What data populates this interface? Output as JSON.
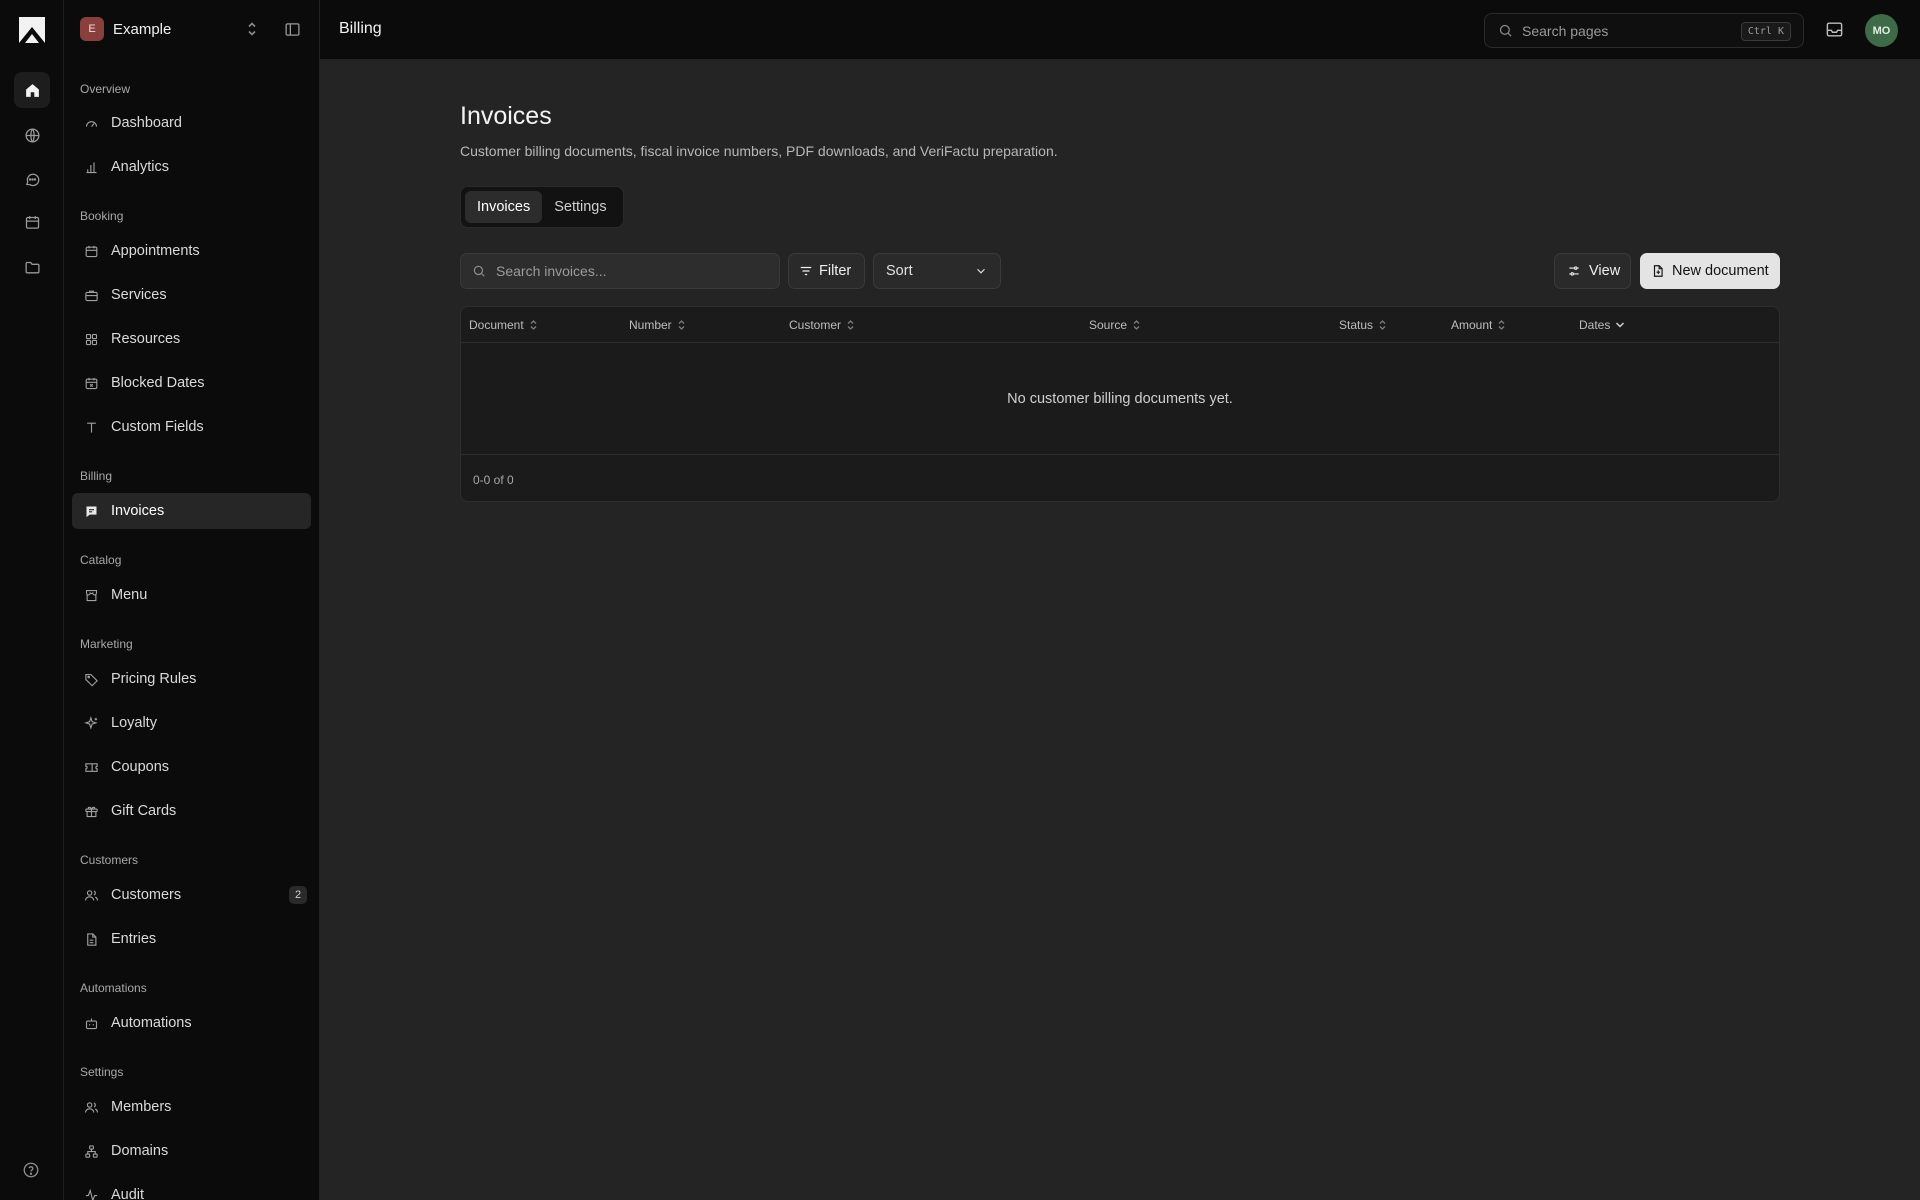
{
  "workspace": {
    "initial": "E",
    "name": "Example"
  },
  "topbar": {
    "title": "Billing",
    "search_placeholder": "Search pages",
    "shortcut": "Ctrl K",
    "user_initials": "MO"
  },
  "sidebar": {
    "sections": [
      {
        "label": "Overview",
        "items": [
          {
            "label": "Dashboard",
            "icon": "gauge-icon"
          },
          {
            "label": "Analytics",
            "icon": "bar-chart-icon"
          }
        ]
      },
      {
        "label": "Booking",
        "items": [
          {
            "label": "Appointments",
            "icon": "calendar-icon"
          },
          {
            "label": "Services",
            "icon": "briefcase-icon"
          },
          {
            "label": "Resources",
            "icon": "grid-icon"
          },
          {
            "label": "Blocked Dates",
            "icon": "calendar-x-icon"
          },
          {
            "label": "Custom Fields",
            "icon": "text-icon"
          }
        ]
      },
      {
        "label": "Billing",
        "items": [
          {
            "label": "Invoices",
            "icon": "invoice-icon",
            "active": true
          }
        ]
      },
      {
        "label": "Catalog",
        "items": [
          {
            "label": "Menu",
            "icon": "store-icon"
          }
        ]
      },
      {
        "label": "Marketing",
        "items": [
          {
            "label": "Pricing Rules",
            "icon": "tag-icon"
          },
          {
            "label": "Loyalty",
            "icon": "sparkle-icon"
          },
          {
            "label": "Coupons",
            "icon": "ticket-icon"
          },
          {
            "label": "Gift Cards",
            "icon": "gift-icon"
          }
        ]
      },
      {
        "label": "Customers",
        "items": [
          {
            "label": "Customers",
            "icon": "users-icon",
            "badge": "2"
          },
          {
            "label": "Entries",
            "icon": "file-icon"
          }
        ]
      },
      {
        "label": "Automations",
        "items": [
          {
            "label": "Automations",
            "icon": "bot-icon"
          }
        ]
      },
      {
        "label": "Settings",
        "items": [
          {
            "label": "Members",
            "icon": "users-icon"
          },
          {
            "label": "Domains",
            "icon": "network-icon"
          },
          {
            "label": "Audit",
            "icon": "activity-icon"
          }
        ]
      }
    ]
  },
  "main": {
    "title": "Invoices",
    "description": "Customer billing documents, fiscal invoice numbers, PDF downloads, and VeriFactu preparation.",
    "tabs": [
      {
        "label": "Invoices",
        "active": true
      },
      {
        "label": "Settings"
      }
    ],
    "search_placeholder": "Search invoices...",
    "filter_label": "Filter",
    "sort_label": "Sort",
    "view_label": "View",
    "new_label": "New document",
    "columns": [
      "Document",
      "Number",
      "Customer",
      "Source",
      "Status",
      "Amount",
      "Dates"
    ],
    "empty_text": "No customer billing documents yet.",
    "pagination": "0-0 of 0"
  }
}
